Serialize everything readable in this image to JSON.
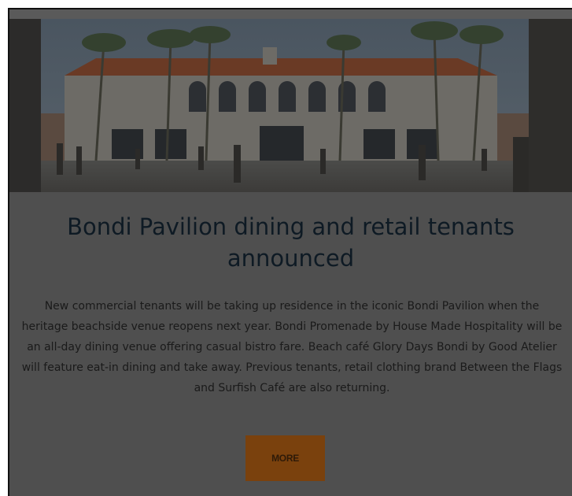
{
  "article": {
    "image_alt": "Bondi Pavilion building with palm trees and people walking in the forecourt",
    "title": "Bondi Pavilion dining and retail tenants announced",
    "summary": "New commercial tenants will be taking up residence in the iconic Bondi Pavilion when the heritage beachside venue reopens next year. Bondi Promenade by House Made Hospitality will be an all-day dining venue offering casual bistro fare. Beach café Glory Days Bondi by Good Atelier will feature eat-in dining and take away. Previous tenants, retail clothing brand Between the Flags and Surfish Café are also returning.",
    "more_label": "MORE"
  },
  "colors": {
    "overlay_bg": "#4f4f4f",
    "button_bg": "#7a410d",
    "title_color": "#0e1a24"
  }
}
